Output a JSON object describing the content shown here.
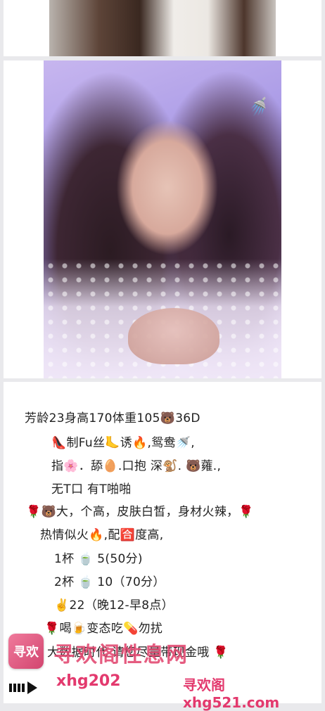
{
  "post": {
    "photos": [
      {
        "alt": "photo-1"
      },
      {
        "alt": "photo-2"
      }
    ],
    "profile_lines": [
      "芳龄23身高170体重105🐻36D",
      "👠制Fu丝🦶诱🔥,鸳鸯🚿,",
      "指🌸．舔🥚.口抱 深🐒. 🐻蕹.,",
      "无T口   有T啪啪",
      "🌹🐻大，个高，皮肤白皙，身材火辣，🌹",
      "热情似火🔥,配🈴度高,",
      "1杯    🍵  5(50分)",
      "2杯    🍵  10（70分）",
      "✌️22（晚12-早8点）",
      "🌹喝🍺变态吃💊勿扰",
      "大数据时代 请您尽量带现金哦 🌹"
    ]
  },
  "watermark": {
    "logo_text": "寻欢",
    "site_name": "寻欢阁性息网",
    "url_left": "xhg202",
    "url_right": "寻欢阁xhg521.com"
  },
  "colors": {
    "watermark": "#e33a6e",
    "background": "#e9e9ec"
  }
}
